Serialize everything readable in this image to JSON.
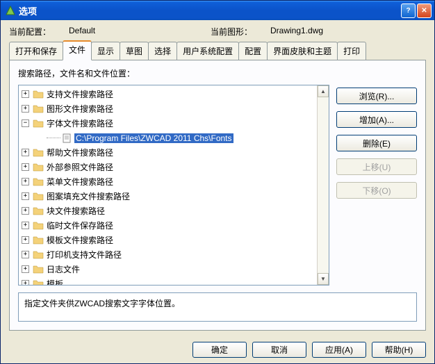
{
  "window": {
    "title": "选项"
  },
  "info": {
    "currentConfigLabel": "当前配置：",
    "currentConfigValue": "Default",
    "currentDrawingLabel": "当前图形：",
    "currentDrawingValue": "Drawing1.dwg"
  },
  "tabs": [
    {
      "label": "打开和保存"
    },
    {
      "label": "文件"
    },
    {
      "label": "显示"
    },
    {
      "label": "草图"
    },
    {
      "label": "选择"
    },
    {
      "label": "用户系统配置"
    },
    {
      "label": "配置"
    },
    {
      "label": "界面皮肤和主题"
    },
    {
      "label": "打印"
    }
  ],
  "panelTitle": "搜索路径，文件名和文件位置：",
  "tree": {
    "items": [
      {
        "label": "支持文件搜索路径",
        "expanded": false
      },
      {
        "label": "图形文件搜索路径",
        "expanded": false
      },
      {
        "label": "字体文件搜索路径",
        "expanded": true
      },
      {
        "label": "帮助文件搜索路径",
        "expanded": false
      },
      {
        "label": "外部参照文件路径",
        "expanded": false
      },
      {
        "label": "菜单文件搜索路径",
        "expanded": false
      },
      {
        "label": "图案填充文件搜索路径",
        "expanded": false
      },
      {
        "label": "块文件搜索路径",
        "expanded": false
      },
      {
        "label": "临时文件保存路径",
        "expanded": false
      },
      {
        "label": "模板文件搜索路径",
        "expanded": false
      },
      {
        "label": "打印机支持文件路径",
        "expanded": false
      },
      {
        "label": "日志文件",
        "expanded": false
      },
      {
        "label": "模板",
        "expanded": false
      }
    ],
    "childPath": "C:\\Program Files\\ZWCAD 2011 Chs\\Fonts"
  },
  "sideButtons": {
    "browse": "浏览(R)...",
    "add": "增加(A)...",
    "delete": "删除(E)",
    "moveUp": "上移(U)",
    "moveDown": "下移(O)"
  },
  "description": "指定文件夹供ZWCAD搜索文字字体位置。",
  "bottomButtons": {
    "ok": "确定",
    "cancel": "取消",
    "apply": "应用(A)",
    "help": "帮助(H)"
  }
}
